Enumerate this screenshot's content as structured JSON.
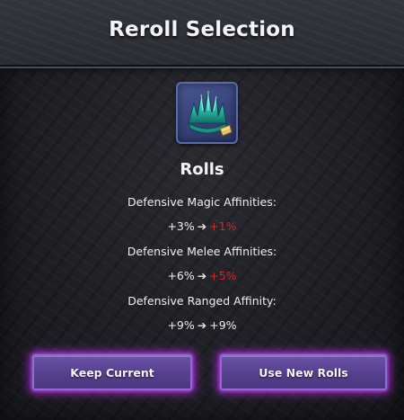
{
  "header": {
    "title": "Reroll Selection"
  },
  "item": {
    "icon": "crystal-helm-icon"
  },
  "rolls": {
    "title": "Rolls",
    "stats": [
      {
        "label": "Defensive Magic Affinities:",
        "current": "+3%",
        "new": "+1%",
        "new_color": "#d8232a"
      },
      {
        "label": "Defensive Melee Affinities:",
        "current": "+6%",
        "new": "+5%",
        "new_color": "#d8232a"
      },
      {
        "label": "Defensive Ranged Affinity:",
        "current": "+9%",
        "new": "+9%",
        "new_color": "#eeeef2"
      }
    ]
  },
  "buttons": {
    "keep_label": "Keep Current",
    "new_label": "Use New Rolls"
  },
  "colors": {
    "worse": "#d8232a",
    "button": "#5a4393",
    "glow": "#aa28dc"
  }
}
